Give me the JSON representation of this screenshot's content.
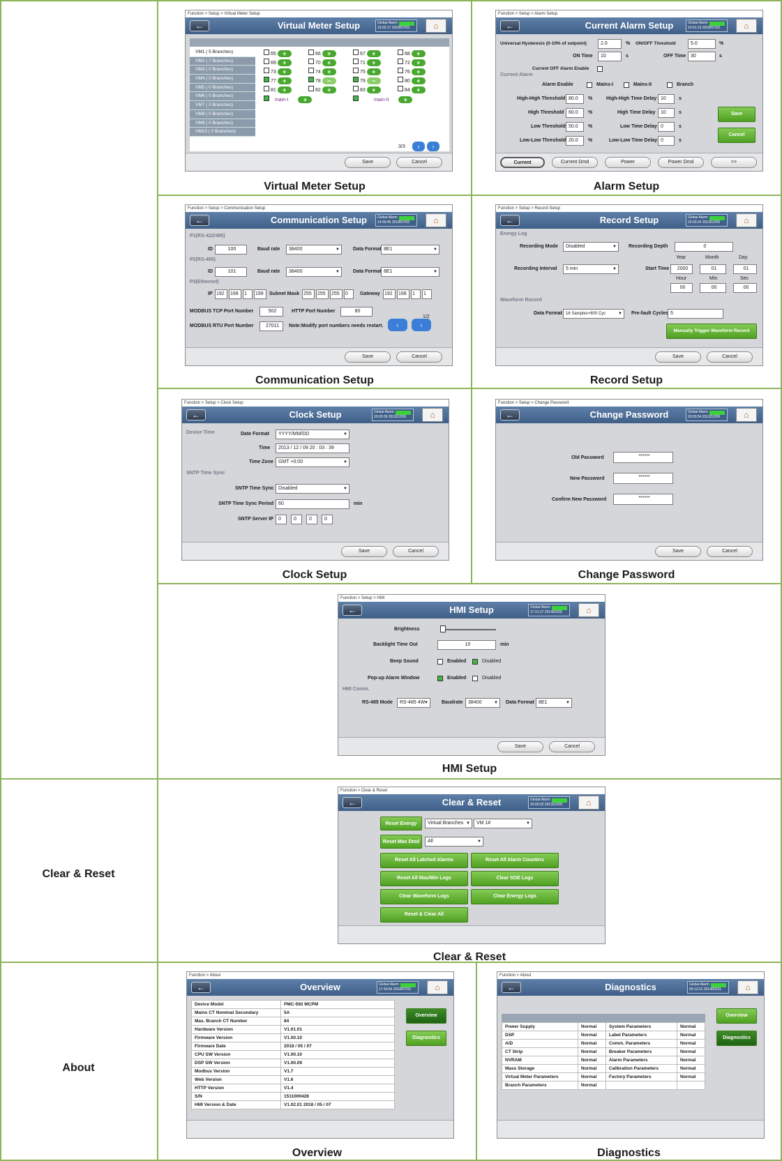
{
  "rows": {
    "clear_label": "Clear & Reset",
    "about_label": "About"
  },
  "captions": {
    "vm": "Virtual Meter Setup",
    "alarm": "Alarm Setup",
    "comm": "Communication Setup",
    "record": "Record Setup",
    "clock": "Clock Setup",
    "pwd": "Change Password",
    "hmi": "HMI Setup",
    "clear": "Clear & Reset",
    "overview": "Overview",
    "diag": "Diagnostics"
  },
  "common": {
    "back": "←",
    "home": "⌂",
    "ga": "Global Alarm",
    "save": "Save",
    "cancel": "Cancel"
  },
  "vm": {
    "bc": "Function > Setup > Virtual Meter Setup",
    "title": "Virtual Meter Setup",
    "ts": "15:02:17 2018/07/03",
    "list": [
      "VM1  ( 5 Branches)",
      "VM2  ( 7 Branches)",
      "VM3  ( 0 Branches)",
      "VM4  ( 0 Branches)",
      "VM5  ( 0 Branches)",
      "VM6  ( 0 Branches)",
      "VM7  ( 0 Branches)",
      "VM8  ( 0 Branches)",
      "VM9  ( 0 Branches)",
      "VM10 ( 0 Branches)"
    ],
    "cells": [
      "65",
      "66",
      "67",
      "68",
      "69",
      "70",
      "71",
      "72",
      "73",
      "74",
      "75",
      "76",
      "77",
      "78",
      "79",
      "80",
      "81",
      "82",
      "83",
      "84"
    ],
    "mains1": "main-I",
    "mains2": "main-II",
    "page": "3/3"
  },
  "alarm": {
    "bc": "Function > Setup > Alarm Setup",
    "title": "Current Alarm Setup",
    "ts": "14:51:13 2018/07/03",
    "hyst_label": "Universal Hysteresis (0-10% of setpoint)",
    "hyst": "2.0",
    "pct": "%",
    "onoff_label": "ON/OFF Threshold",
    "onoff": "5.0",
    "on_label": "ON Time",
    "on": "10",
    "s": "s",
    "off_label": "OFF Time",
    "off": "30",
    "curoff": "Current OFF Alarm Enable",
    "sec": "Current Alarm",
    "en": "Alarm Enable",
    "m1": "Mains-I",
    "m2": "Mains-II",
    "br": "Branch",
    "hh": "High-High Threshold",
    "hhv": "80.0",
    "hhd": "High-High Time Delay",
    "hhdv": "10",
    "h": "High Threshold",
    "hv": "60.0",
    "hd": "High Time Delay",
    "hdv": "10",
    "l": "Low Threshold",
    "lv": "50.0",
    "ld": "Low Time Delay",
    "ldv": "0",
    "ll": "Low-Low Threshold",
    "llv": "20.0",
    "lld": "Low-Low Time Delay",
    "lldv": "0",
    "tabs": [
      "Current",
      "Current Dmd",
      "Power",
      "Power Dmd",
      ">>"
    ]
  },
  "comm": {
    "bc": "Function > Setup > Communication Setup",
    "title": "Communication Setup",
    "ts": "14:50:45 2018/07/03",
    "p1": "P1(RS-422/485)",
    "p2": "P2(RS-485)",
    "p3": "P3(Ethernet)",
    "id": "ID",
    "id1": "100",
    "id2": "101",
    "baud": "Baud rate",
    "b1": "38400",
    "b2": "38400",
    "df": "Data Format",
    "d1": "8E1",
    "d2": "8E1",
    "ip": "IP",
    "ipv": [
      "192",
      "168",
      "1",
      "199"
    ],
    "mask": "Subnet Mask",
    "maskv": [
      "255",
      "255",
      "255",
      "0"
    ],
    "gw": "Gateway",
    "gwv": [
      "192",
      "168",
      "1",
      "1"
    ],
    "tcp": "MODBUS TCP Port Number",
    "tcpv": "502",
    "http": "HTTP Port Number",
    "httpv": "80",
    "rtu": "MODBUS RTU Port Number",
    "rtuv": "27011",
    "note": "Note:Modify port numbers needs restart.",
    "page": "1/2"
  },
  "record": {
    "bc": "Function > Setup > Record Setup",
    "title": "Record Setup",
    "ts": "20:03:24 2013/12/09",
    "energy": "Energy Log",
    "mode": "Recording Mode",
    "modev": "Disabled",
    "depth": "Recording Depth",
    "depthv": "0",
    "year": "Year",
    "month": "Month",
    "day": "Day",
    "interval": "Recording Interval",
    "intv": "5 min",
    "start": "Start Time",
    "yv": "2000",
    "mv": "01",
    "dv": "01",
    "hour": "Hour",
    "min": "Min",
    "sec": "Sec",
    "hv": "00",
    "minv": "00",
    "sv": "00",
    "wave": "Waveform Record",
    "df": "Data Format",
    "dfv": "16 Samples×600 Cyc",
    "pre": "Pre-fault Cycles",
    "prev": "5",
    "trig": "Manually Trigger Waveform Record"
  },
  "clock": {
    "bc": "Function > Setup > Clock Setup",
    "title": "Clock Setup",
    "ts": "20:03:39 2013/12/09",
    "devtime": "Device Time",
    "dfmt": "Date Format",
    "dfmtv": "YYYY/MM/DD",
    "time": "Time",
    "timev": "2013 / 12 / 09   20 : 03 : 39",
    "tz": "Time Zone",
    "tzv": "GMT +0:00",
    "sntp": "SNTP Time Sync",
    "sync": "SNTP Time Sync",
    "syncv": "Disabled",
    "period": "SNTP Time Sync Period",
    "periodv": "60",
    "minu": "min",
    "server": "SNTP Server IP",
    "sv": [
      "0",
      "0",
      "0",
      "0"
    ]
  },
  "pwd": {
    "bc": "Function > Setup > Change Password",
    "title": "Change Password",
    "ts": "20:03:54 2013/12/09",
    "old": "Old Password",
    "new": "New Password",
    "conf": "Confirm New Password",
    "mask": "******"
  },
  "hmi": {
    "bc": "Function > Setup > HMI",
    "title": "HMI Setup",
    "ts": "17:21:17 2014/03/26",
    "bright": "Brightness",
    "back": "Backlight Time Out",
    "backv": "10",
    "minu": "min",
    "beep": "Beep Sound",
    "enabled": "Enabled",
    "disabled": "Disabled",
    "popup": "Pop-up Alarm Window",
    "comm": "HMI Comm.",
    "rs": "RS-485 Mode",
    "rsv": "RS-485 4W",
    "baud": "Baudrate",
    "baudv": "38400",
    "df": "Data Format",
    "dfv": "8E1"
  },
  "clear": {
    "bc": "Function > Clear & Reset",
    "title": "Clear & Reset",
    "ts": "20:05:02 2013/12/09",
    "reset_energy": "Reset Energy",
    "vb": "Virtual Branches",
    "vm": "VM 1#",
    "reset_dmd": "Reset Max Dmd",
    "all": "All",
    "b1": "Reset All Latched Alarms",
    "b2": "Reset All Alarm Counters",
    "b3": "Reset All Max/Min Logs",
    "b4": "Clear SOE Logs",
    "b5": "Clear Waveform Logs",
    "b6": "Clear Energy Logs",
    "b7": "Reset & Clear All"
  },
  "overview": {
    "bc": "Function > About",
    "title": "Overview",
    "ts": "17:43:55 2018/07/03",
    "btn_ov": "Overview",
    "btn_diag": "Diagnostics",
    "rows": [
      [
        "Device Model",
        "PMC-592 MCPM"
      ],
      [
        "Mains CT Nominal Secondary",
        "5A"
      ],
      [
        "Max. Branch CT Number",
        "84"
      ],
      [
        "Hardware Version",
        "V1.01.01"
      ],
      [
        "Firmware Version",
        "V1.00.10"
      ],
      [
        "Firmware Date",
        "2018 / 05 / 07"
      ],
      [
        "CPU SW Version",
        "V1.00.10"
      ],
      [
        "DSP SW Version",
        "V1.00.09"
      ],
      [
        "Modbus Version",
        "V1.7"
      ],
      [
        "Web Version",
        "V1.6"
      ],
      [
        "HTTP Version",
        "V1.4"
      ],
      [
        "S/N",
        "1511000428"
      ],
      [
        "HMI Version & Date",
        "V1.02.01  2018 / 05 / 07"
      ]
    ]
  },
  "diag": {
    "bc": "Function > About",
    "title": "Diagnostics",
    "ts": "09:12:21 2014/03/31",
    "btn_ov": "Overview",
    "btn_diag": "Diagnostics",
    "rows": [
      [
        "Power Supply",
        "Normal",
        "System Parameters",
        "Normal"
      ],
      [
        "DSP",
        "Normal",
        "Label Parameters",
        "Normal"
      ],
      [
        "A/D",
        "Normal",
        "Comm. Parameters",
        "Normal"
      ],
      [
        "CT Strip",
        "Normal",
        "Breaker Parameters",
        "Normal"
      ],
      [
        "NVRAM",
        "Normal",
        "Alarm Parameters",
        "Normal"
      ],
      [
        "Mass Storage",
        "Normal",
        "Calibration Parameters",
        "Normal"
      ],
      [
        "Virtual Meter Parameters",
        "Normal",
        "Factory Parameters",
        "Normal"
      ],
      [
        "Branch Parameters",
        "Normal",
        "",
        ""
      ]
    ]
  }
}
